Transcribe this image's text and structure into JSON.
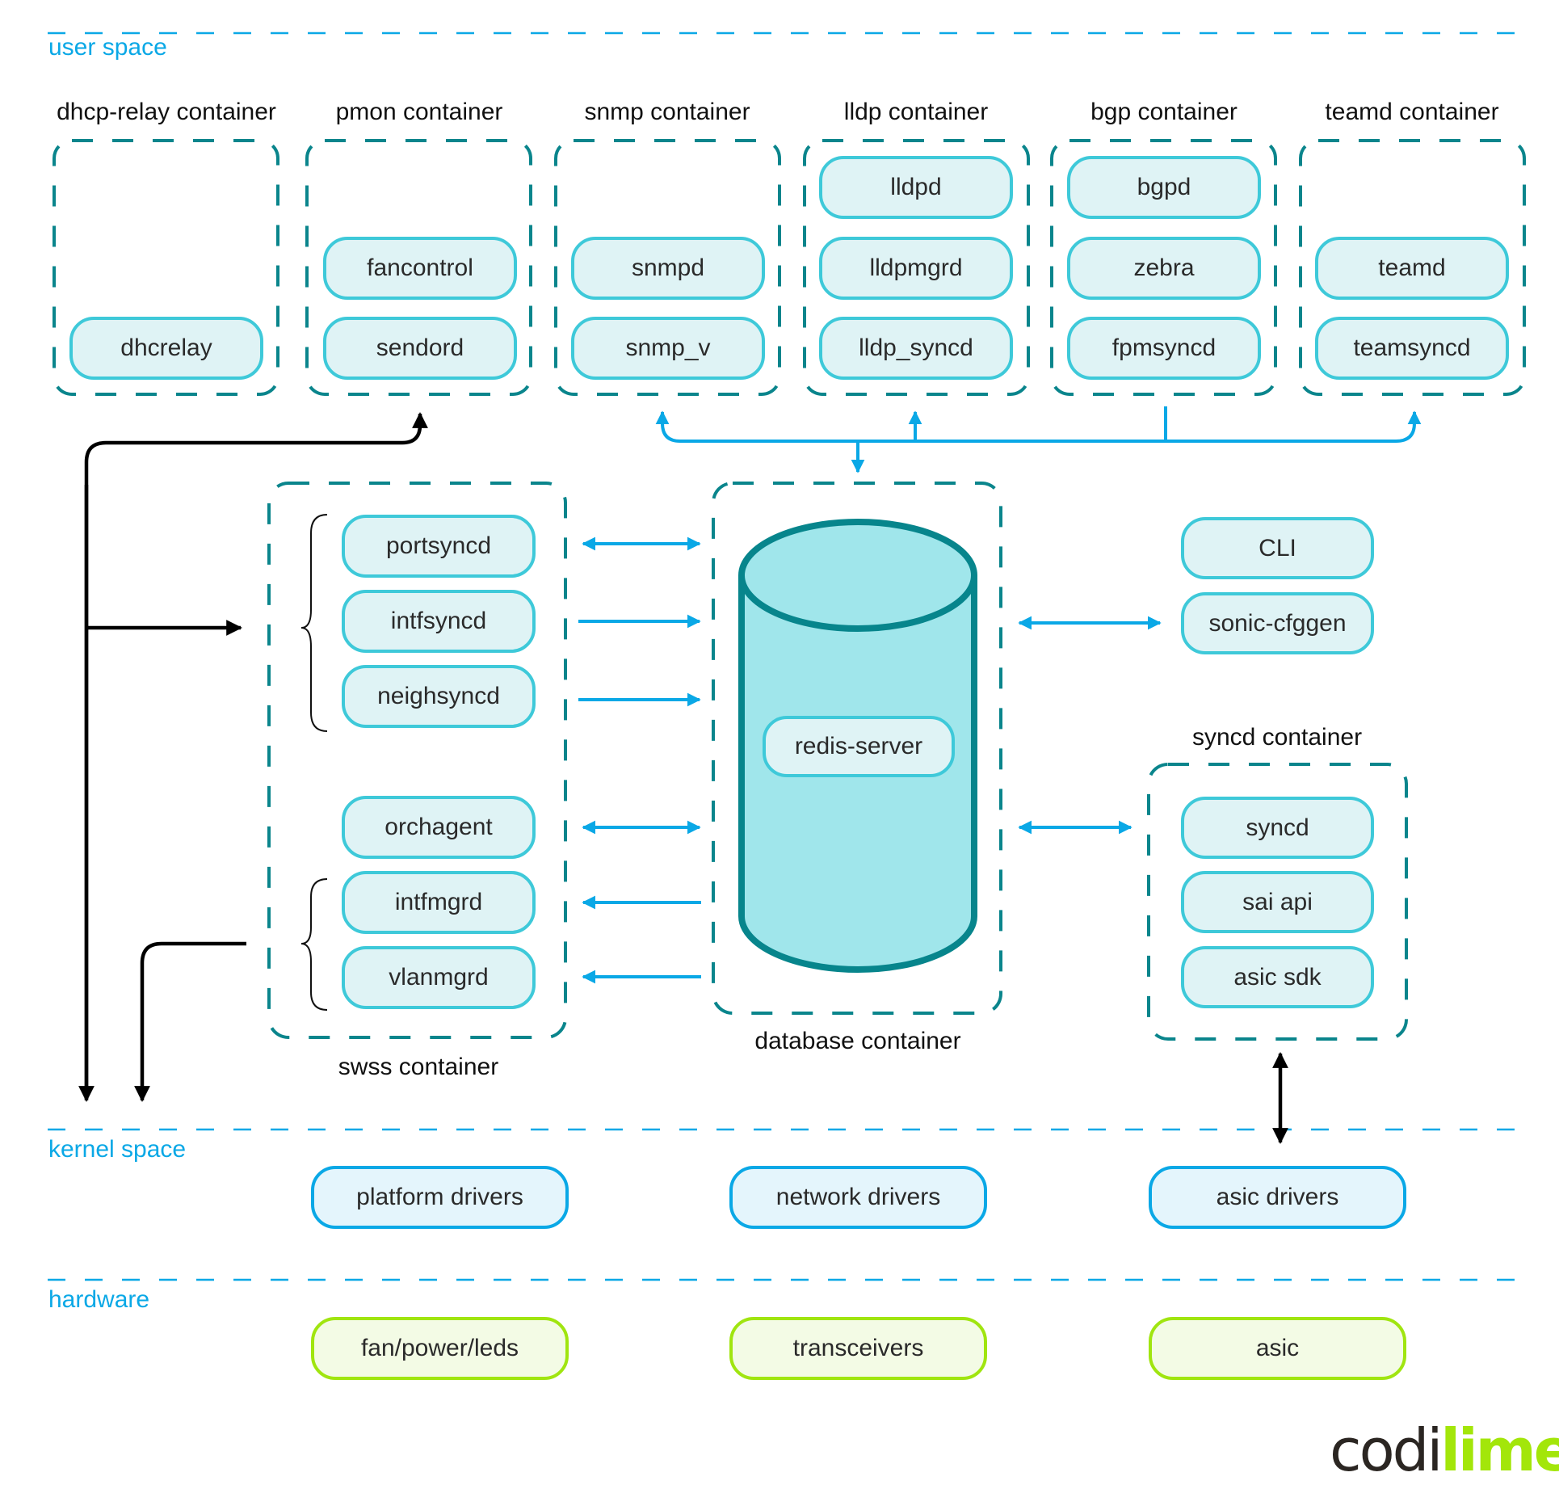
{
  "zones": {
    "user_space": "user space",
    "kernel_space": "kernel space",
    "hardware": "hardware"
  },
  "top_containers": [
    {
      "label": "dhcp-relay container",
      "processes": [
        "",
        "",
        "dhcrelay"
      ]
    },
    {
      "label": "pmon container",
      "processes": [
        "",
        "fancontrol",
        "sendord"
      ]
    },
    {
      "label": "snmp container",
      "processes": [
        "",
        "snmpd",
        "snmp_v"
      ]
    },
    {
      "label": "lldp container",
      "processes": [
        "lldpd",
        "lldpmgrd",
        "lldp_syncd"
      ]
    },
    {
      "label": "bgp container",
      "processes": [
        "bgpd",
        "zebra",
        "fpmsyncd"
      ]
    },
    {
      "label": "teamd container",
      "processes": [
        "",
        "teamd",
        "teamsyncd"
      ]
    }
  ],
  "swss": {
    "label": "swss container",
    "processes": [
      "portsyncd",
      "intfsyncd",
      "neighsyncd",
      "orchagent",
      "intfmgrd",
      "vlanmgrd"
    ]
  },
  "database": {
    "label": "database container",
    "process": "redis-server"
  },
  "tools": [
    "CLI",
    "sonic-cfggen"
  ],
  "syncd": {
    "label": "syncd container",
    "processes": [
      "syncd",
      "sai api",
      "asic sdk"
    ]
  },
  "kernel_drivers": [
    "platform drivers",
    "network drivers",
    "asic drivers"
  ],
  "hardware_items": [
    "fan/power/leds",
    "transceivers",
    "asic"
  ],
  "flows": {
    "swss_to_db": [
      "bidirectional",
      "to-db",
      "to-db",
      "bidirectional",
      "to-swss",
      "to-swss"
    ],
    "db_to_cli": "bidirectional",
    "db_to_syncd": "bidirectional",
    "syncd_to_asic_drivers": "bidirectional"
  },
  "logo": {
    "part1": "codi",
    "part2": "lime"
  },
  "colors": {
    "zone_line": "#0aa8e6",
    "container_dash": "#0a858c",
    "pill_border": "#3ec9d9",
    "pill_fill": "#dff3f5",
    "kernel_border": "#0aa8e6",
    "kernel_fill": "#e4f5fc",
    "hw_border": "#a0e510",
    "hw_fill": "#f3fbe5",
    "arrow_blue": "#0aa8e6",
    "arrow_black": "#000000",
    "cylinder_fill": "#a0e6eb",
    "cylinder_stroke": "#07858c",
    "logo_dark": "#2b2622",
    "logo_lime": "#a3e60a"
  }
}
